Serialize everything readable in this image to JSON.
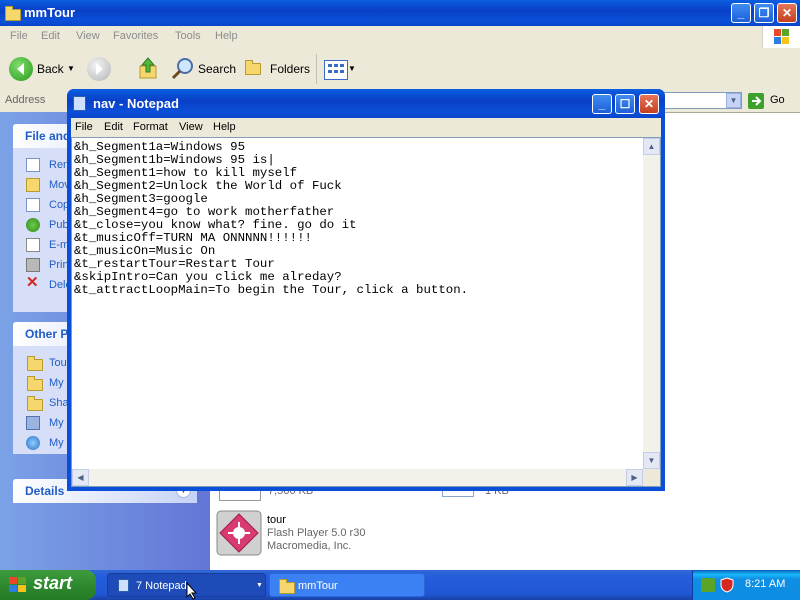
{
  "explorer": {
    "title": "mmTour",
    "menu": [
      "File",
      "Edit",
      "View",
      "Favorites",
      "Tools",
      "Help"
    ],
    "toolbar": {
      "back": "Back",
      "search": "Search",
      "folders": "Folders"
    },
    "address": {
      "label": "Address",
      "go": "Go"
    },
    "left_panels": {
      "file_tasks": {
        "title": "File and",
        "items": [
          "Ren",
          "Mov",
          "Cop",
          "Pub",
          "E-m",
          "Prin",
          "Dele"
        ]
      },
      "other_places": {
        "title": "Other P",
        "items": [
          "Tou",
          "My",
          "Sha",
          "My",
          "My"
        ]
      },
      "details": {
        "title": "Details"
      }
    },
    "content": {
      "file1_size": "7,566 KB",
      "file2_size": "1 KB",
      "tour": {
        "name": "tour",
        "type": "Flash Player 5.0 r30",
        "company": "Macromedia, Inc."
      }
    }
  },
  "notepad": {
    "title": "nav - Notepad",
    "menu": [
      "File",
      "Edit",
      "Format",
      "View",
      "Help"
    ],
    "text": "&h_Segment1a=Windows 95\n&h_Segment1b=Windows 95 is|\n&h_Segment1=how to kill myself\n&h_Segment2=Unlock the World of Fuck\n&h_Segment3=google\n&h_Segment4=go to work motherfather\n&t_close=you know what? fine. go do it\n&t_musicOff=TURN MA ONNNNN!!!!!!\n&t_musicOn=Music On\n&t_restartTour=Restart Tour\n&skipIntro=Can you click me alreday?\n&t_attractLoopMain=To begin the Tour, click a button."
  },
  "taskbar": {
    "start": "start",
    "tasks": [
      {
        "label": "7 Notepad"
      },
      {
        "label": "mmTour"
      }
    ],
    "clock": "8:21 AM"
  },
  "colors": {
    "xp_blue": "#0a4fd8",
    "start_green": "#2f8a2f",
    "panel_blue": "#d6dff7"
  }
}
